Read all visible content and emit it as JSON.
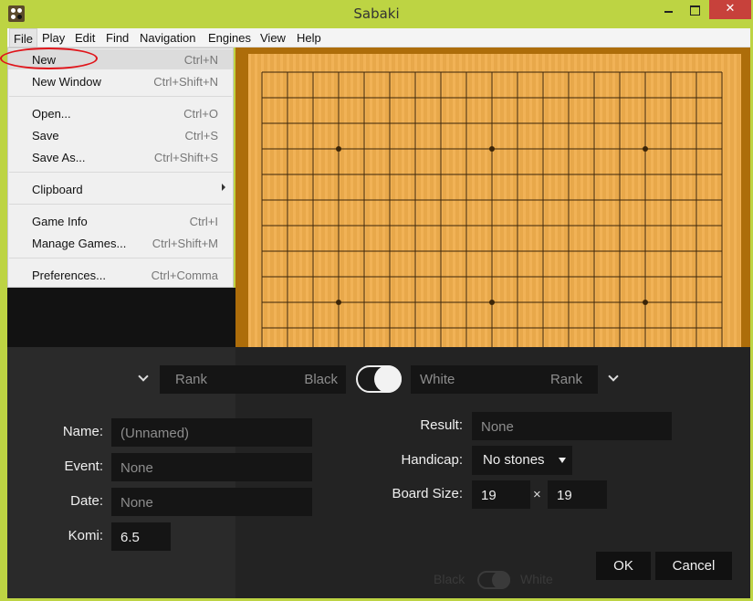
{
  "window": {
    "title": "Sabaki",
    "app_icon": "go-stones-icon",
    "close_glyph": "✕"
  },
  "menubar": {
    "items": [
      "File",
      "Play",
      "Edit",
      "Find",
      "Navigation",
      "Engines",
      "View",
      "Help"
    ]
  },
  "file_menu": {
    "items": [
      {
        "label": "New",
        "shortcut": "Ctrl+N"
      },
      {
        "label": "New Window",
        "shortcut": "Ctrl+Shift+N"
      },
      {
        "label": "Open...",
        "shortcut": "Ctrl+O"
      },
      {
        "label": "Save",
        "shortcut": "Ctrl+S"
      },
      {
        "label": "Save As...",
        "shortcut": "Ctrl+Shift+S"
      },
      {
        "label": "Clipboard",
        "shortcut": ""
      },
      {
        "label": "Game Info",
        "shortcut": "Ctrl+I"
      },
      {
        "label": "Manage Games...",
        "shortcut": "Ctrl+Shift+M"
      },
      {
        "label": "Preferences...",
        "shortcut": "Ctrl+Comma"
      }
    ]
  },
  "board": {
    "size": 19
  },
  "players": {
    "black": {
      "rank_placeholder": "Rank",
      "name_placeholder": "Black"
    },
    "white": {
      "name_placeholder": "White",
      "rank_placeholder": "Rank"
    }
  },
  "game_info": {
    "name_label": "Name:",
    "name_placeholder": "(Unnamed)",
    "event_label": "Event:",
    "event_placeholder": "None",
    "date_label": "Date:",
    "date_placeholder": "None",
    "komi_label": "Komi:",
    "komi_value": "6.5",
    "result_label": "Result:",
    "result_placeholder": "None",
    "handicap_label": "Handicap:",
    "handicap_value": "No stones",
    "board_size_label": "Board Size:",
    "board_width": "19",
    "board_height": "19",
    "times_glyph": "×"
  },
  "buttons": {
    "ok": "OK",
    "cancel": "Cancel"
  },
  "status_bar": {
    "black": "Black",
    "white": "White"
  },
  "colors": {
    "frame": "#bdd443",
    "highlight_oval": "#e0141a",
    "board": "#f0ad4c",
    "drawer": "#2a2a2a"
  }
}
